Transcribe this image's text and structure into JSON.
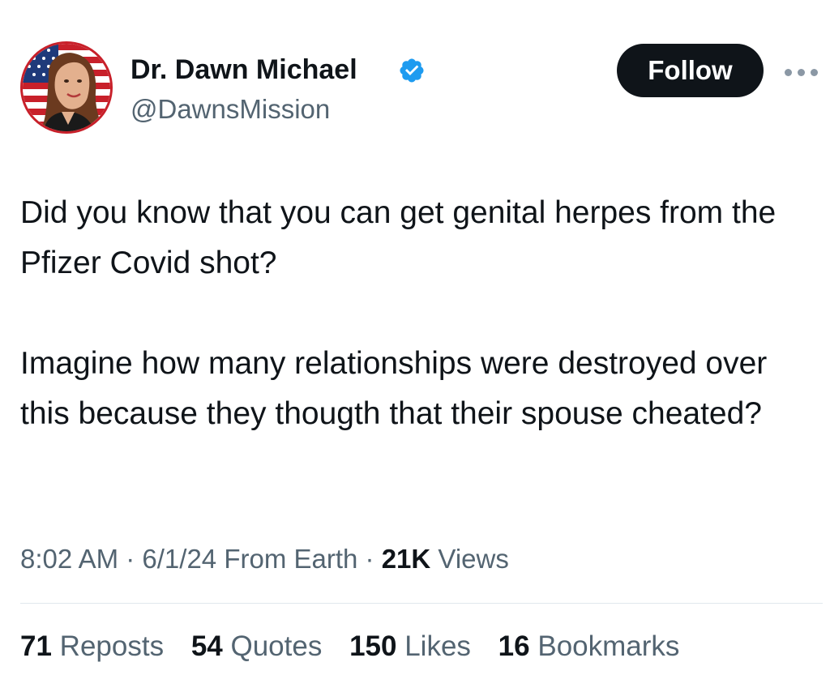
{
  "author": {
    "display_name": "Dr. Dawn Michael",
    "handle": "@DawnsMission",
    "verified": true
  },
  "actions": {
    "follow_label": "Follow"
  },
  "tweet": {
    "paragraphs": [
      "Did you know that you can get genital herpes from the Pfizer Covid shot?",
      "Imagine how many relationships were destroyed over this because they thougth that their spouse cheated?"
    ]
  },
  "meta": {
    "time": "8:02 AM",
    "sep1": " · ",
    "date": "6/1/24",
    "location": " From Earth",
    "sep2": " · ",
    "views_count": "21K",
    "views_label": " Views"
  },
  "stats": [
    {
      "count": "71",
      "label": "Reposts"
    },
    {
      "count": "54",
      "label": "Quotes"
    },
    {
      "count": "150",
      "label": "Likes"
    },
    {
      "count": "16",
      "label": "Bookmarks"
    }
  ],
  "colors": {
    "text_primary": "#0f1419",
    "text_secondary": "#536471",
    "verified_blue": "#1d9bf0",
    "follow_bg": "#0f1419",
    "avatar_ring": "#c8202a"
  }
}
